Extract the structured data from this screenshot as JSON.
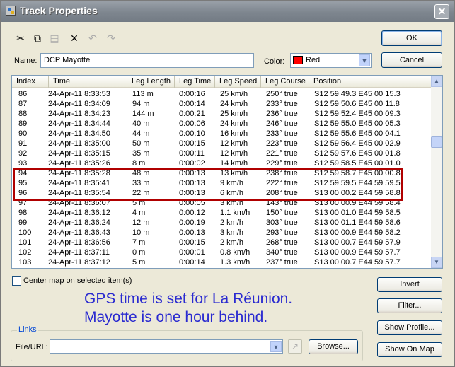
{
  "window": {
    "title": "Track Properties",
    "close_glyph": "✕"
  },
  "toolbar": {
    "buttons": [
      {
        "icon": "cut-icon",
        "glyph": "✂",
        "enabled": true
      },
      {
        "icon": "copy-icon",
        "glyph": "⧉",
        "enabled": true
      },
      {
        "icon": "paste-icon",
        "glyph": "▤",
        "enabled": false
      },
      {
        "icon": "delete-icon",
        "glyph": "✕",
        "enabled": true
      },
      {
        "icon": "undo-icon",
        "glyph": "↶",
        "enabled": false
      },
      {
        "icon": "redo-icon",
        "glyph": "↷",
        "enabled": false
      }
    ]
  },
  "form": {
    "name_label": "Name:",
    "name_value": "DCP Mayotte",
    "color_label": "Color:",
    "color_value": "Red",
    "color_swatch": "#ff0000"
  },
  "buttons": {
    "ok": "OK",
    "cancel": "Cancel",
    "invert": "Invert",
    "filter": "Filter...",
    "show_profile": "Show Profile...",
    "show_on_map": "Show On Map",
    "browse": "Browse..."
  },
  "table": {
    "columns": [
      "Index",
      "Time",
      "Leg Length",
      "Leg Time",
      "Leg Speed",
      "Leg Course",
      "Position"
    ],
    "rows": [
      [
        "86",
        "24-Apr-11 8:33:53",
        "113 m",
        "0:00:16",
        "25 km/h",
        "250° true",
        "S12 59 49.3 E45 00 15.3"
      ],
      [
        "87",
        "24-Apr-11 8:34:09",
        "94 m",
        "0:00:14",
        "24 km/h",
        "233° true",
        "S12 59 50.6 E45 00 11.8"
      ],
      [
        "88",
        "24-Apr-11 8:34:23",
        "144 m",
        "0:00:21",
        "25 km/h",
        "236° true",
        "S12 59 52.4 E45 00 09.3"
      ],
      [
        "89",
        "24-Apr-11 8:34:44",
        "40 m",
        "0:00:06",
        "24 km/h",
        "246° true",
        "S12 59 55.0 E45 00 05.3"
      ],
      [
        "90",
        "24-Apr-11 8:34:50",
        "44 m",
        "0:00:10",
        "16 km/h",
        "233° true",
        "S12 59 55.6 E45 00 04.1"
      ],
      [
        "91",
        "24-Apr-11 8:35:00",
        "50 m",
        "0:00:15",
        "12 km/h",
        "223° true",
        "S12 59 56.4 E45 00 02.9"
      ],
      [
        "92",
        "24-Apr-11 8:35:15",
        "35 m",
        "0:00:11",
        "12 km/h",
        "221° true",
        "S12 59 57.6 E45 00 01.8"
      ],
      [
        "93",
        "24-Apr-11 8:35:26",
        "8 m",
        "0:00:02",
        "14 km/h",
        "229° true",
        "S12 59 58.5 E45 00 01.0"
      ],
      [
        "94",
        "24-Apr-11 8:35:28",
        "48 m",
        "0:00:13",
        "13 km/h",
        "238° true",
        "S12 59 58.7 E45 00 00.8"
      ],
      [
        "95",
        "24-Apr-11 8:35:41",
        "33 m",
        "0:00:13",
        "9 km/h",
        "222° true",
        "S12 59 59.5 E44 59 59.5"
      ],
      [
        "96",
        "24-Apr-11 8:35:54",
        "22 m",
        "0:00:13",
        "6 km/h",
        "208° true",
        "S13 00 00.2 E44 59 58.8"
      ],
      [
        "97",
        "24-Apr-11 8:36:07",
        "5 m",
        "0:00:05",
        "3 km/h",
        "143° true",
        "S13 00 00.9 E44 59 58.4"
      ],
      [
        "98",
        "24-Apr-11 8:36:12",
        "4 m",
        "0:00:12",
        "1.1 km/h",
        "150° true",
        "S13 00 01.0 E44 59 58.5"
      ],
      [
        "99",
        "24-Apr-11 8:36:24",
        "12 m",
        "0:00:19",
        "2 km/h",
        "303° true",
        "S13 00 01.1 E44 59 58.6"
      ],
      [
        "100",
        "24-Apr-11 8:36:43",
        "10 m",
        "0:00:13",
        "3 km/h",
        "293° true",
        "S13 00 00.9 E44 59 58.2"
      ],
      [
        "101",
        "24-Apr-11 8:36:56",
        "7 m",
        "0:00:15",
        "2 km/h",
        "268° true",
        "S13 00 00.7 E44 59 57.9"
      ],
      [
        "102",
        "24-Apr-11 8:37:11",
        "0 m",
        "0:00:01",
        "0.8 km/h",
        "340° true",
        "S13 00 00.9 E44 59 57.7"
      ],
      [
        "103",
        "24-Apr-11 8:37:12",
        "5 m",
        "0:00:14",
        "1.3 km/h",
        "237° true",
        "S13 00 00.7 E44 59 57.7"
      ]
    ],
    "highlighted_rows": [
      "94",
      "95",
      "96"
    ],
    "highlight_color": "#b00000"
  },
  "center_map": {
    "label": "Center map on selected item(s)",
    "checked": false
  },
  "annotation": {
    "line1": "GPS time is set for La Réunion.",
    "line2": "Mayotte is one hour behind.",
    "color": "#2a2ad0"
  },
  "links": {
    "group_label": "Links",
    "file_url_label": "File/URL:",
    "file_url_value": ""
  }
}
